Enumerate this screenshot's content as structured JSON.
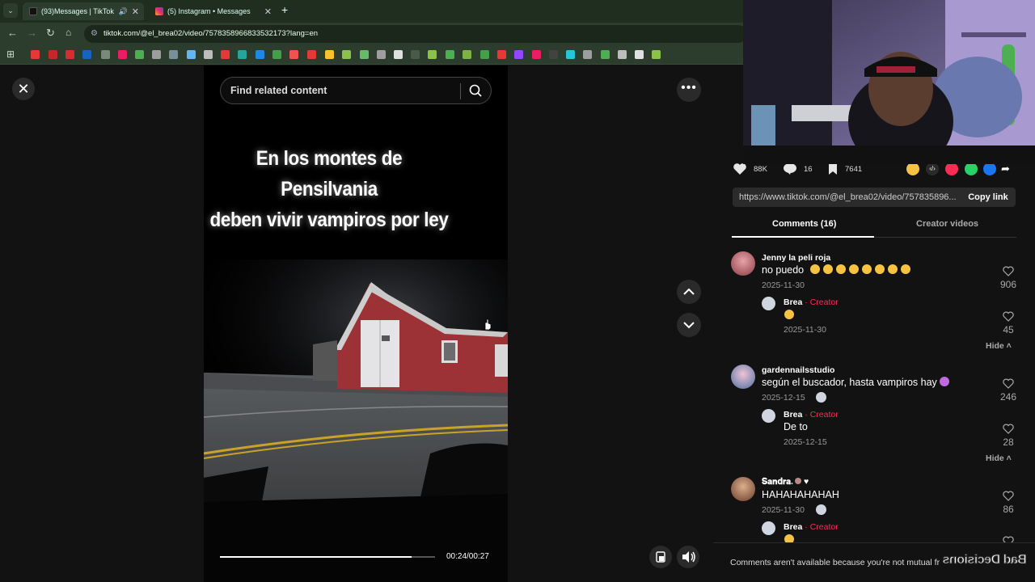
{
  "browser": {
    "tabs": [
      {
        "title": "(93)Messages | TikTok",
        "active": true
      },
      {
        "title": "(5) Instagram • Messages",
        "active": false
      }
    ],
    "url": "tiktok.com/@el_brea02/video/7578358966833532173?lang=en",
    "colors": {
      "chrome": "#2d3d2d",
      "tabbar": "#1f2e1f"
    }
  },
  "video": {
    "search_placeholder": "Find related content",
    "caption_line1": "En los montes de Pensilvania",
    "caption_line2": "deben vivir vampiros por ley",
    "time": "00:24/00:27",
    "progress": 0.89
  },
  "panel": {
    "stats": {
      "likes": "88K",
      "comments": "16",
      "saves": "7641"
    },
    "link": "https://www.tiktok.com/@el_brea02/video/757835896...",
    "copy_link": "Copy link",
    "tabs": {
      "comments": "Comments (16)",
      "creator_videos": "Creator videos"
    },
    "comments": [
      {
        "user": "Jenny la peli roja",
        "text": "no puedo",
        "date": "2025-11-30",
        "likes": "906",
        "reply": {
          "user": "Brea",
          "creator": "Creator",
          "text": "",
          "date": "2025-11-30",
          "likes": "45"
        },
        "hide": "Hide"
      },
      {
        "user": "gardennailsstudio",
        "text": "según el buscador, hasta vampiros hay",
        "date": "2025-12-15",
        "likes": "246",
        "reply": {
          "user": "Brea",
          "creator": "Creator",
          "text": "De to",
          "date": "2025-12-15",
          "likes": "28"
        },
        "hide": "Hide"
      },
      {
        "user": "𝐒𝐚𝐧𝐝𝐫𝐚.",
        "text": "HAHAHAHAHAH",
        "date": "2025-11-30",
        "likes": "86",
        "reply": {
          "user": "Brea",
          "creator": "Creator",
          "text": "",
          "date": "",
          "likes": ""
        }
      }
    ],
    "separator": " · ",
    "footer": "Comments aren't available because you're not mutual fr",
    "watermark": "Bad Decisions"
  }
}
